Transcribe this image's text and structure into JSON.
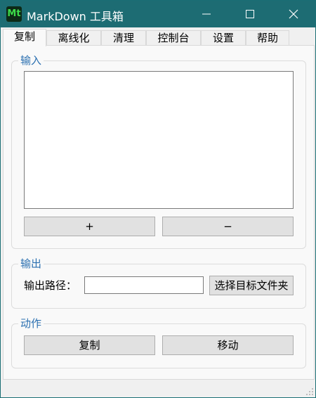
{
  "window": {
    "title": "MarkDown 工具箱",
    "icon_text": "Mt",
    "controls": [
      "minimize-icon",
      "maximize-icon",
      "close-icon"
    ]
  },
  "tabs": [
    {
      "label": "复制",
      "active": true
    },
    {
      "label": "离线化",
      "active": false
    },
    {
      "label": "清理",
      "active": false
    },
    {
      "label": "控制台",
      "active": false
    },
    {
      "label": "设置",
      "active": false
    },
    {
      "label": "帮助",
      "active": false
    }
  ],
  "input_group": {
    "legend": "输入",
    "add_label": "+",
    "remove_label": "−"
  },
  "output_group": {
    "legend": "输出",
    "path_label": "输出路径：",
    "path_value": "",
    "browse_label": "选择目标文件夹"
  },
  "action_group": {
    "legend": "动作",
    "copy_label": "复制",
    "move_label": "移动"
  },
  "colors": {
    "titlebar": "#1d6c73",
    "legend_text": "#2a6fb0",
    "app_icon_bg": "#0d2a16",
    "app_icon_fg": "#3ddc4a"
  }
}
